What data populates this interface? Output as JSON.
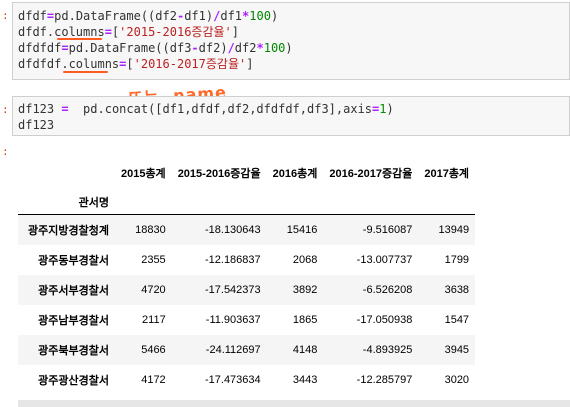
{
  "cell1": {
    "lines": [
      [
        {
          "t": "dfdf"
        },
        {
          "t": "=",
          "c": "op"
        },
        {
          "t": "pd.DataFrame((df2"
        },
        {
          "t": "-",
          "c": "op"
        },
        {
          "t": "df1)"
        },
        {
          "t": "/",
          "c": "op"
        },
        {
          "t": "df1"
        },
        {
          "t": "*",
          "c": "op"
        },
        {
          "t": "100",
          "c": "num"
        },
        {
          "t": ")"
        }
      ],
      [
        {
          "t": "dfdf.columns"
        },
        {
          "t": "=",
          "c": "op"
        },
        {
          "t": "["
        },
        {
          "t": "'2015-2016증감율'",
          "c": "str"
        },
        {
          "t": "]"
        }
      ],
      [
        {
          "t": "dfdfdf"
        },
        {
          "t": "=",
          "c": "op"
        },
        {
          "t": "pd.DataFrame((df3"
        },
        {
          "t": "-",
          "c": "op"
        },
        {
          "t": "df2)"
        },
        {
          "t": "/",
          "c": "op"
        },
        {
          "t": "df2"
        },
        {
          "t": "*",
          "c": "op"
        },
        {
          "t": "100",
          "c": "num"
        },
        {
          "t": ")"
        }
      ],
      [
        {
          "t": "dfdfdf.columns"
        },
        {
          "t": "=",
          "c": "op"
        },
        {
          "t": "["
        },
        {
          "t": "'2016-2017증감율'",
          "c": "str"
        },
        {
          "t": "]"
        }
      ]
    ],
    "annotation": "또는 .name"
  },
  "cell2": {
    "lines": [
      [
        {
          "t": "df123 "
        },
        {
          "t": "=",
          "c": "op"
        },
        {
          "t": "  pd.concat([df1,dfdf,df2,dfdfdf,df3],axis"
        },
        {
          "t": "=",
          "c": "op"
        },
        {
          "t": "1",
          "c": "num"
        },
        {
          "t": ")"
        }
      ],
      [
        {
          "t": "df123"
        }
      ]
    ]
  },
  "table": {
    "columns": [
      "2015총계",
      "2015-2016증감율",
      "2016총계",
      "2016-2017증감율",
      "2017총계"
    ],
    "index_name": "관서명",
    "rows": [
      {
        "index": "광주지방경찰청계",
        "values": [
          "18830",
          "-18.130643",
          "15416",
          "-9.516087",
          "13949"
        ]
      },
      {
        "index": "광주동부경찰서",
        "values": [
          "2355",
          "-12.186837",
          "2068",
          "-13.007737",
          "1799"
        ]
      },
      {
        "index": "광주서부경찰서",
        "values": [
          "4720",
          "-17.542373",
          "3892",
          "-6.526208",
          "3638"
        ]
      },
      {
        "index": "광주남부경찰서",
        "values": [
          "2117",
          "-11.903637",
          "1865",
          "-17.050938",
          "1547"
        ]
      },
      {
        "index": "광주북부경찰서",
        "values": [
          "5466",
          "-24.112697",
          "4148",
          "-4.893925",
          "3945"
        ]
      },
      {
        "index": "광주광산경찰서",
        "values": [
          "4172",
          "-17.473634",
          "3443",
          "-12.285797",
          "3020"
        ]
      }
    ]
  }
}
